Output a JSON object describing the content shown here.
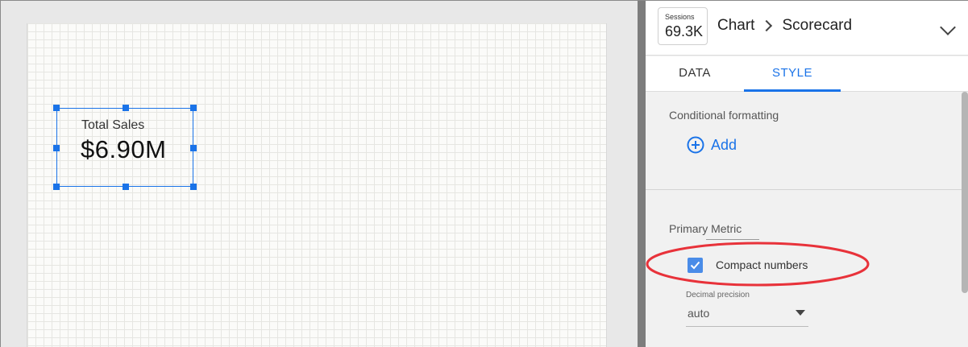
{
  "canvas": {
    "scorecard": {
      "label": "Total Sales",
      "value": "$6.90M"
    }
  },
  "header": {
    "chip": {
      "label": "Sessions",
      "value": "69.3K"
    },
    "breadcrumb": [
      "Chart",
      "Scorecard"
    ]
  },
  "tabs": [
    {
      "label": "DATA",
      "active": false
    },
    {
      "label": "STYLE",
      "active": true
    }
  ],
  "style": {
    "conditional_formatting": {
      "title": "Conditional formatting",
      "add_label": "Add"
    },
    "primary_metric": {
      "title": "Primary Metric",
      "compact_numbers": {
        "label": "Compact numbers",
        "checked": true
      },
      "decimal_precision": {
        "label": "Decimal precision",
        "value": "auto"
      }
    }
  },
  "colors": {
    "accent": "#1a73e8",
    "highlight": "#e8323a"
  },
  "icons": [
    "add-circle-icon",
    "chevron-right-icon",
    "chevron-down-icon",
    "check-icon",
    "dropdown-caret-icon"
  ]
}
